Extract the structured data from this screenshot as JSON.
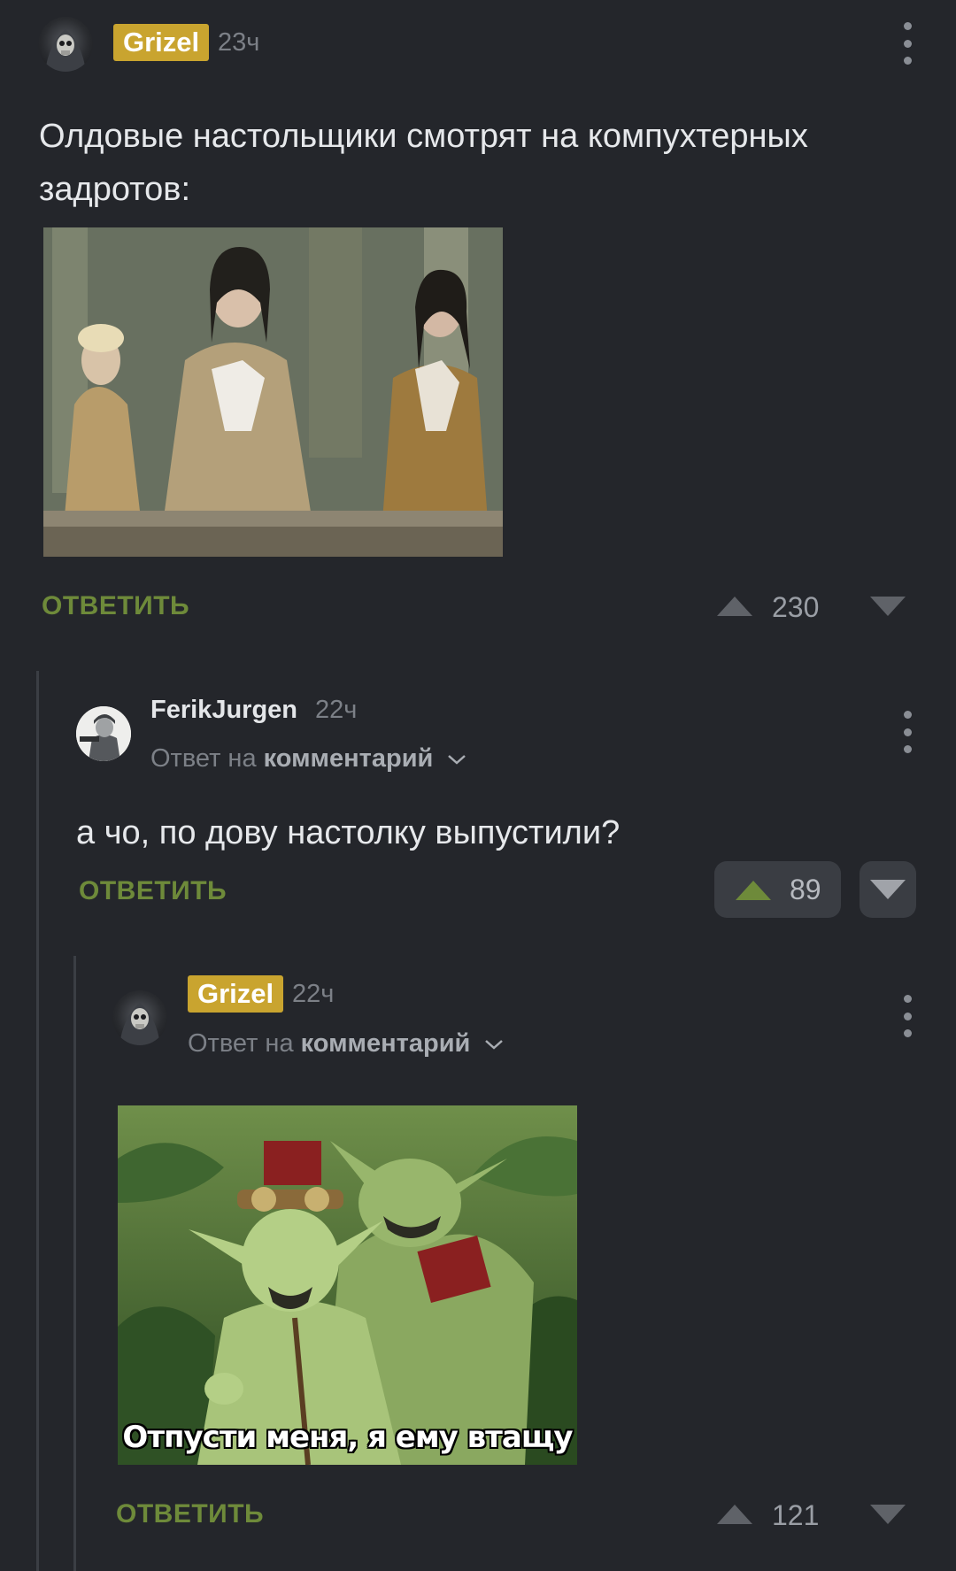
{
  "comments": [
    {
      "author": "Grizel",
      "time": "23ч",
      "text": "Олдовые настольщики смотрят на компухтерных задротов:",
      "reply_label": "ОТВЕТИТЬ",
      "score": "230"
    },
    {
      "author": "FerikJurgen",
      "time": "22ч",
      "reply_to_prefix": "Ответ на",
      "reply_to_target": "комментарий",
      "text": "а чо, по дову настолку выпустили?",
      "reply_label": "ОТВЕТИТЬ",
      "score": "89"
    },
    {
      "author": "Grizel",
      "time": "22ч",
      "reply_to_prefix": "Ответ на",
      "reply_to_target": "комментарий",
      "image_caption": "Отпусти меня, я ему втащу",
      "reply_label": "ОТВЕТИТЬ",
      "score": "121"
    }
  ],
  "colors": {
    "background": "#24262b",
    "badge": "#c9a42f",
    "reply_button": "#6e8a3a",
    "upvote_active": "#6e8a3a"
  },
  "icons": [
    "more-vertical-icon",
    "upvote-arrow-icon",
    "downvote-arrow-icon",
    "chevron-down-icon"
  ]
}
